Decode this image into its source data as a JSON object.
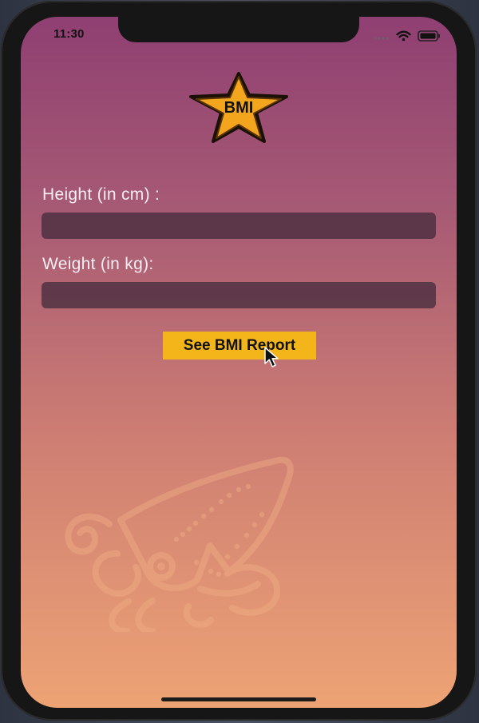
{
  "status_bar": {
    "time": "11:30"
  },
  "logo": {
    "text": "BMI"
  },
  "form": {
    "height_label": "Height (in cm) :",
    "height_value": "",
    "weight_label": "Weight (in kg):",
    "weight_value": ""
  },
  "actions": {
    "see_report_label": "See BMI Report"
  },
  "colors": {
    "gradient_top": "#8f3f72",
    "gradient_bottom": "#eea374",
    "button": "#f3b51a",
    "logo_star": "#f3a51d"
  },
  "icons": {
    "signal": "cellular-signal-icon",
    "wifi": "wifi-icon",
    "battery": "battery-icon",
    "cursor": "mouse-pointer-icon",
    "background_art": "squid-watermark-icon"
  }
}
